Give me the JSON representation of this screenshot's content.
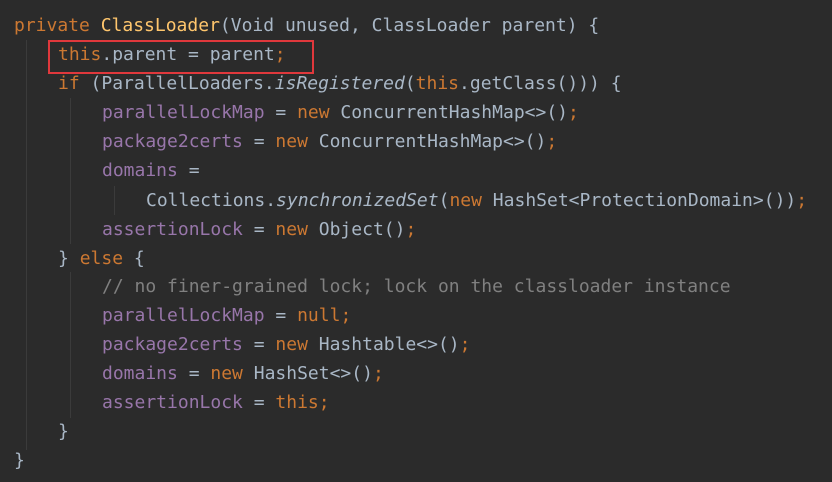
{
  "code": {
    "l1": {
      "private": "private",
      "sp": " ",
      "classloader": "ClassLoader",
      "params": "(Void unused, ClassLoader parent) {"
    },
    "l2": {
      "this": "this",
      "rest": ".parent = parent",
      "semi": ";"
    },
    "l3": {
      "if": "if",
      "a": " (ParallelLoaders.",
      "isreg": "isRegistered",
      "b": "(",
      "this": "this",
      "c": ".getClass())) {"
    },
    "l4": {
      "field": "parallelLockMap",
      "eq": " = ",
      "new": "new",
      "rest": " ConcurrentHashMap<>()",
      "semi": ";"
    },
    "l5": {
      "field": "package2certs",
      "eq": " = ",
      "new": "new",
      "rest": " ConcurrentHashMap<>()",
      "semi": ";"
    },
    "l6": {
      "field": "domains",
      "eq": " ="
    },
    "l7": {
      "a": "Collections.",
      "sync": "synchronizedSet",
      "b": "(",
      "new": "new",
      "rest": " HashSet<ProtectionDomain>())",
      "semi": ";"
    },
    "l8": {
      "field": "assertionLock",
      "eq": " = ",
      "new": "new",
      "rest": " Object()",
      "semi": ";"
    },
    "l9": {
      "brace": "} ",
      "else": "else",
      "rest": " {"
    },
    "l10": {
      "comment": "// no finer-grained lock; lock on the classloader instance"
    },
    "l11": {
      "field": "parallelLockMap",
      "eq": " = ",
      "null": "null",
      "semi": ";"
    },
    "l12": {
      "field": "package2certs",
      "eq": " = ",
      "new": "new",
      "rest": " Hashtable<>()",
      "semi": ";"
    },
    "l13": {
      "field": "domains",
      "eq": " = ",
      "new": "new",
      "rest": " HashSet<>()",
      "semi": ";"
    },
    "l14": {
      "field": "assertionLock",
      "eq": " = ",
      "this": "this",
      "semi": ";"
    },
    "l15": {
      "brace": "}"
    },
    "l16": {
      "brace": "}"
    }
  },
  "colors": {
    "background": "#2b2b2b",
    "keyword": "#cc7832",
    "method_decl": "#ffc66d",
    "field": "#9876aa",
    "comment": "#808080",
    "default": "#a9b7c6",
    "highlight_border": "#e0383c"
  }
}
